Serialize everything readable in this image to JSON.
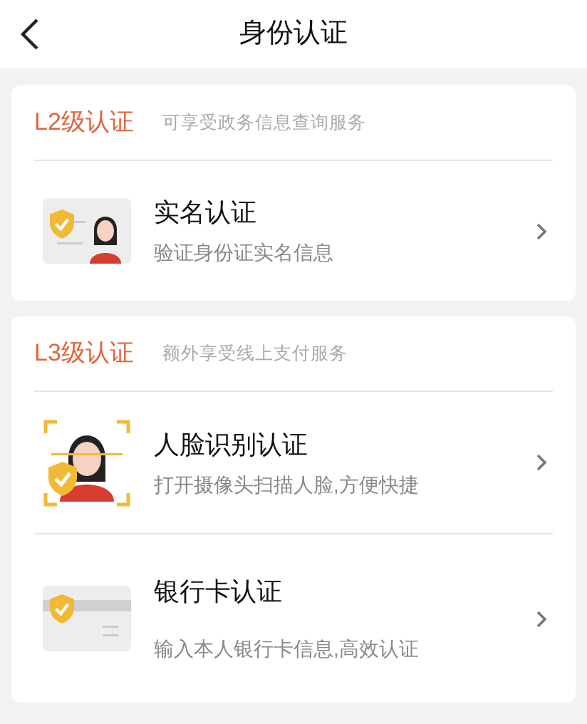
{
  "header": {
    "title": "身份认证"
  },
  "sections": [
    {
      "level": "L2级认证",
      "note": "可享受政务信息查询服务",
      "items": [
        {
          "kind": "id",
          "title": "实名认证",
          "subtitle": "验证身份证实名信息"
        }
      ]
    },
    {
      "level": "L3级认证",
      "note": "额外享受线上支付服务",
      "items": [
        {
          "kind": "face",
          "title": "人脸识别认证",
          "subtitle": "打开摄像头扫描人脸,方便快捷"
        },
        {
          "kind": "card",
          "title": "银行卡认证",
          "subtitle": "输入本人银行卡信息,高效认证"
        }
      ]
    }
  ]
}
